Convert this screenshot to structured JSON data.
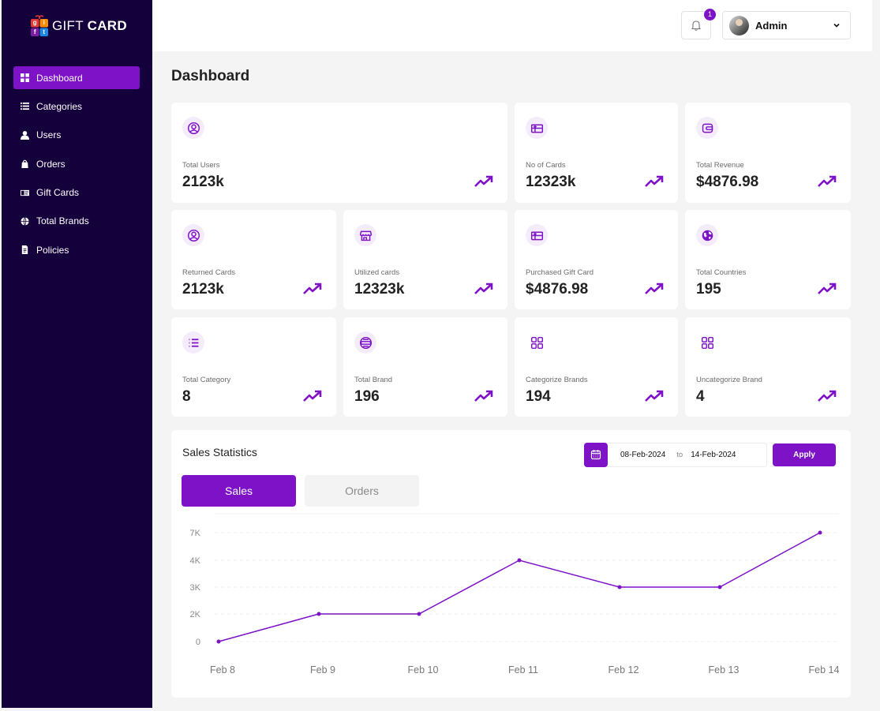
{
  "brand": {
    "logo_letters": [
      "g",
      "i",
      "f",
      "t"
    ],
    "name_light": "GIFT",
    "name_bold": "CARD"
  },
  "sidebar": {
    "items": [
      {
        "label": "Dashboard",
        "icon": "grid-icon",
        "active": true
      },
      {
        "label": "Categories",
        "icon": "list-icon"
      },
      {
        "label": "Users",
        "icon": "user-icon"
      },
      {
        "label": "Orders",
        "icon": "bag-icon"
      },
      {
        "label": "Gift Cards",
        "icon": "card-icon"
      },
      {
        "label": "Total Brands",
        "icon": "globe-icon"
      },
      {
        "label": "Policies",
        "icon": "document-icon"
      }
    ]
  },
  "header": {
    "notification_count": "1",
    "user_name": "Admin"
  },
  "page_title": "Dashboard",
  "cards": [
    {
      "label": "Total Users",
      "value": "2123k",
      "icon": "user-circle-icon"
    },
    {
      "label": "No of Cards",
      "value": "12323k",
      "icon": "gift-card-icon"
    },
    {
      "label": "Total Revenue",
      "value": "$4876.98",
      "icon": "wallet-icon"
    },
    {
      "label": "Returned Cards",
      "value": "2123k",
      "icon": "user-circle-icon"
    },
    {
      "label": "Utilized cards",
      "value": "12323k",
      "icon": "store-icon"
    },
    {
      "label": "Purchased Gift Card",
      "value": "$4876.98",
      "icon": "gift-card-icon"
    },
    {
      "label": "Total Countries",
      "value": "195",
      "icon": "globe-icon"
    },
    {
      "label": "Total Category",
      "value": "8",
      "icon": "list-icon"
    },
    {
      "label": "Total Brand",
      "value": "196",
      "icon": "brand-badge-icon"
    },
    {
      "label": "Categorize Brands",
      "value": "194",
      "icon": "apps-icon"
    },
    {
      "label": "Uncategorize Brand",
      "value": "4",
      "icon": "apps-icon"
    }
  ],
  "sales": {
    "title": "Sales Statistics",
    "date_from": "08-Feb-2024",
    "date_to_label": "to",
    "date_to": "14-Feb-2024",
    "apply_label": "Apply",
    "tabs": [
      "Sales",
      "Orders"
    ]
  },
  "colors": {
    "accent": "#7d12c7",
    "sidebar": "#14003a"
  },
  "chart_data": {
    "type": "line",
    "categories": [
      "Feb 8",
      "Feb 9",
      "Feb 10",
      "Feb 11",
      "Feb 12",
      "Feb 13",
      "Feb 14"
    ],
    "values": [
      0,
      2000,
      2000,
      4000,
      3000,
      3000,
      7000
    ],
    "y_ticks": [
      "0",
      "2K",
      "3K",
      "4K",
      "7K"
    ],
    "y_tick_values": [
      0,
      2000,
      3000,
      4000,
      7000
    ],
    "grid": true
  }
}
